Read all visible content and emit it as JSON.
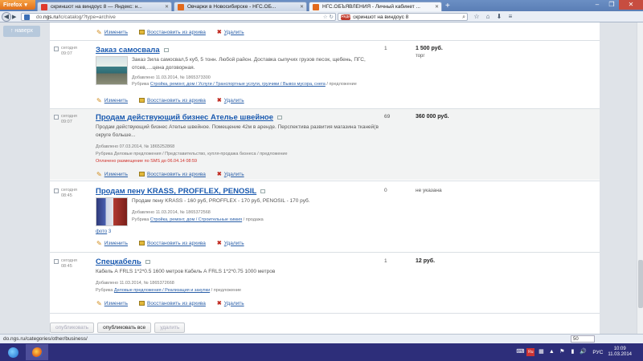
{
  "browser": {
    "menu_label": "Firefox",
    "tabs": [
      {
        "label": "скриншот на виндоус 8 — Яндекс: н...",
        "icon": "yandex-icon",
        "color": "#e03a2e"
      },
      {
        "label": "Овчарки в Новосибирске - НГС.ОБ...",
        "icon": "ngs-icon",
        "color": "#e36a1c"
      },
      {
        "label": "НГС.ОБЪЯВЛЕНИЯ - Личный кабинет ...",
        "icon": "ngs-icon",
        "color": "#e36a1c",
        "active": true
      }
    ],
    "new_tab": "+",
    "url_prefix": "do.",
    "url_domain": "ngs.ru",
    "url_rest": "/lc/catalog/?type=archive",
    "search_engine": "Яндекс",
    "search_query": "скриншот на виндоус 8",
    "status_url": "do.ngs.ru/categories/other/business/",
    "zoom": "50"
  },
  "page": {
    "back_to_top": "↑ наверх",
    "actions": {
      "edit": "Изменить",
      "restore": "Восстановить из архива",
      "delete": "Удалить"
    },
    "listings": [
      {
        "date": "сегодня",
        "time": "09:07",
        "title": "Заказ самосвала",
        "desc": "Заказ Зила самосвал,5 куб, 5 тонн. Любой район. Доставка сыпучих грузов песок, щебень, ПГС, отсев,....цена договорная.",
        "added": "Добавлено 11.03.2014, № 1865373300",
        "rubric_prefix": "Рубрика",
        "rubric": "Стройка, ремонт, дом / Услуги / Транспортные услуги, грузчики / Вывоз мусора, снега",
        "type": "предложение",
        "views": "1",
        "price": "1 500 руб.",
        "price_note": "торг"
      },
      {
        "date": "сегодня",
        "time": "09:07",
        "title": "Продам действующий бизнес Ателье швейное",
        "desc": "Продам действующий бизнес Ателье швейное. Помещение 42м в аренде. Перспектива развития магазина тканей(в округе больше...",
        "added": "Добавлено 07.03.2014, № 1865252868",
        "rubric_prefix": "Рубрика",
        "rubric": "Деловые предложения / Представительство, купля-продажа бизнеса",
        "type": "предложение",
        "paid": "Оплачено размещение по SMS до 06.04.14 08:59",
        "views": "69",
        "price": "360 000 руб."
      },
      {
        "date": "сегодня",
        "time": "08:45",
        "title": "Продам пену KRASS, PROFFLEX, PENOSIL",
        "desc": "Продам пену KRASS - 160 руб, PROFFLEX - 170 руб, PENOSIL - 170 руб.",
        "added": "Добавлено 11.03.2014, № 1865372568",
        "rubric_prefix": "Рубрика",
        "rubric": "Стройка, ремонт, дом / Строительные химия",
        "type": "продажа",
        "photo_label": "фото",
        "photo_count": "3",
        "views": "0",
        "price": "не указана"
      },
      {
        "date": "сегодня",
        "time": "08:45",
        "title": "Спецкабель",
        "desc": "Кабель А FRLS 1*2*0.5 1600 метров Кабель А FRLS 1*2*0.75 1000 метров",
        "added": "Добавлено 11.03.2014, № 1865372668",
        "rubric_prefix": "Рубрика",
        "rubric": "Деловые предложения / Реализация и закупки",
        "type": "предложение",
        "views": "1",
        "price": "12 руб."
      }
    ],
    "bottom_buttons": {
      "publish": "опубликовать",
      "publish_all": "опубликовать все",
      "delete": "удалить"
    }
  },
  "taskbar": {
    "lang": "РУС",
    "time": "10:09",
    "date": "11.03.2014"
  }
}
